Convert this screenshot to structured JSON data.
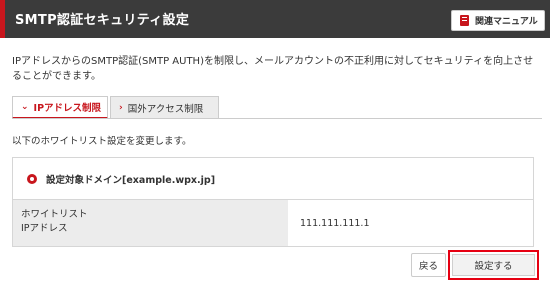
{
  "header": {
    "title": "SMTP認証セキュリティ設定",
    "manual_button": "関連マニュアル",
    "manual_icon": "book-icon"
  },
  "description": "IPアドレスからのSMTP認証(SMTP AUTH)を制限し、メールアカウントの不正利用に対してセキュリティを向上させることができます。",
  "tabs": [
    {
      "label": "IPアドレス制限",
      "active": true,
      "icon": "chevron-down-icon"
    },
    {
      "label": "国外アクセス制限",
      "active": false,
      "icon": "chevron-right-icon"
    }
  ],
  "subtitle": "以下のホワイトリスト設定を変更します。",
  "domain_label": "設定対象ドメイン[example.wpx.jp]",
  "table": {
    "header_line1": "ホワイトリスト",
    "header_line2": "IPアドレス",
    "value": "111.111.111.1"
  },
  "buttons": {
    "back": "戻る",
    "submit": "設定する"
  },
  "colors": {
    "accent": "#c8161d",
    "header_bg": "#3b3b3b",
    "highlight_border": "#e60012"
  }
}
